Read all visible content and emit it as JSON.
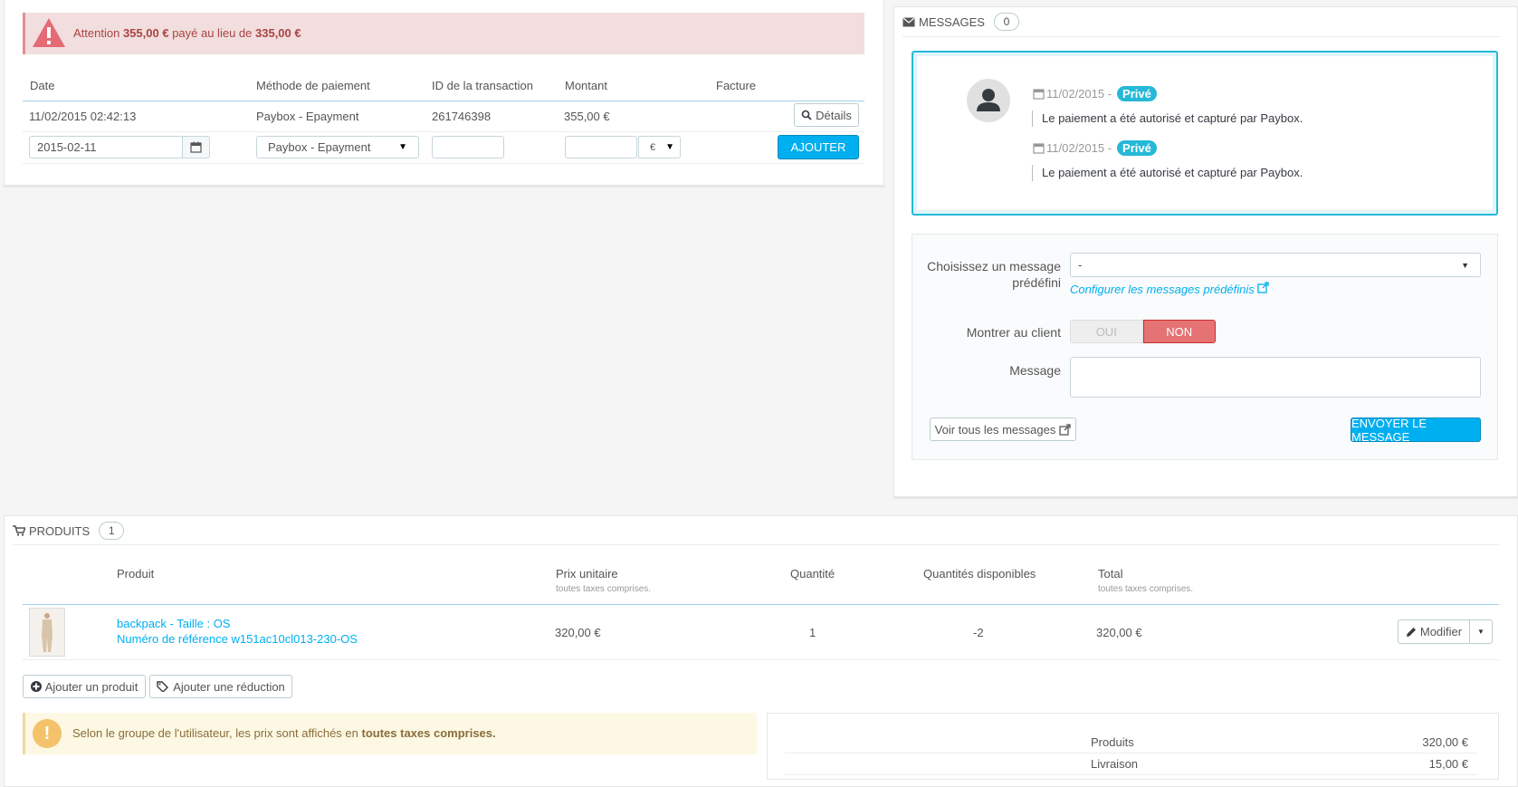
{
  "payment": {
    "alert": {
      "prefix": "Attention",
      "paid": "355,00 €",
      "middle": "payé au lieu de",
      "expected": "335,00 €"
    },
    "headers": [
      "Date",
      "Méthode de paiement",
      "ID de la transaction",
      "Montant",
      "Facture"
    ],
    "row": {
      "date": "11/02/2015 02:42:13",
      "method": "Paybox - Epayment",
      "transaction_id": "261746398",
      "amount": "355,00 €",
      "details_label": "Détails"
    },
    "form": {
      "date_value": "2015-02-11",
      "method_value": "Paybox - Epayment",
      "currency_value": "€",
      "add_label": "AJOUTER"
    }
  },
  "messages": {
    "title": "MESSAGES",
    "count": "0",
    "items": [
      {
        "date": "11/02/2015 -",
        "tag": "Privé",
        "text": "Le paiement a été autorisé et capturé par Paybox."
      },
      {
        "date": "11/02/2015 -",
        "tag": "Privé",
        "text": "Le paiement a été autorisé et capturé par Paybox."
      }
    ],
    "form": {
      "predefined_label_1": "Choisissez un message",
      "predefined_label_2": "prédéfini",
      "predefined_value": "-",
      "configure_link": "Configurer les messages prédéfinis",
      "show_client_label": "Montrer au client",
      "oui": "OUI",
      "non": "NON",
      "message_label": "Message",
      "view_all_label": "Voir tous les messages",
      "send_label": "ENVOYER LE MESSAGE"
    }
  },
  "products": {
    "title": "PRODUITS",
    "count": "1",
    "headers": {
      "product": "Produit",
      "unit_price": "Prix unitaire",
      "unit_price_sub": "toutes taxes comprises.",
      "quantity": "Quantité",
      "available": "Quantités disponibles",
      "total": "Total",
      "total_sub": "toutes taxes comprises."
    },
    "row": {
      "name": "backpack - Taille : OS",
      "reference": "Numéro de référence w151ac10cl013-230-OS",
      "unit_price": "320,00 €",
      "quantity": "1",
      "available": "-2",
      "total": "320,00 €",
      "edit_label": "Modifier"
    },
    "add_product_label": "Ajouter un produit",
    "add_discount_label": "Ajouter une réduction",
    "tax_notice_prefix": "Selon le groupe de l'utilisateur, les prix sont affichés en",
    "tax_notice_bold": "toutes taxes comprises.",
    "totals": [
      {
        "label": "Produits",
        "value": "320,00 €"
      },
      {
        "label": "Livraison",
        "value": "15,00 €"
      }
    ]
  },
  "colors": {
    "primary": "#00aff0",
    "info": "#25b9d7",
    "danger_bg": "#f2dede",
    "warning_bg": "#fcf8e3",
    "toggle_off": "#e57373"
  }
}
